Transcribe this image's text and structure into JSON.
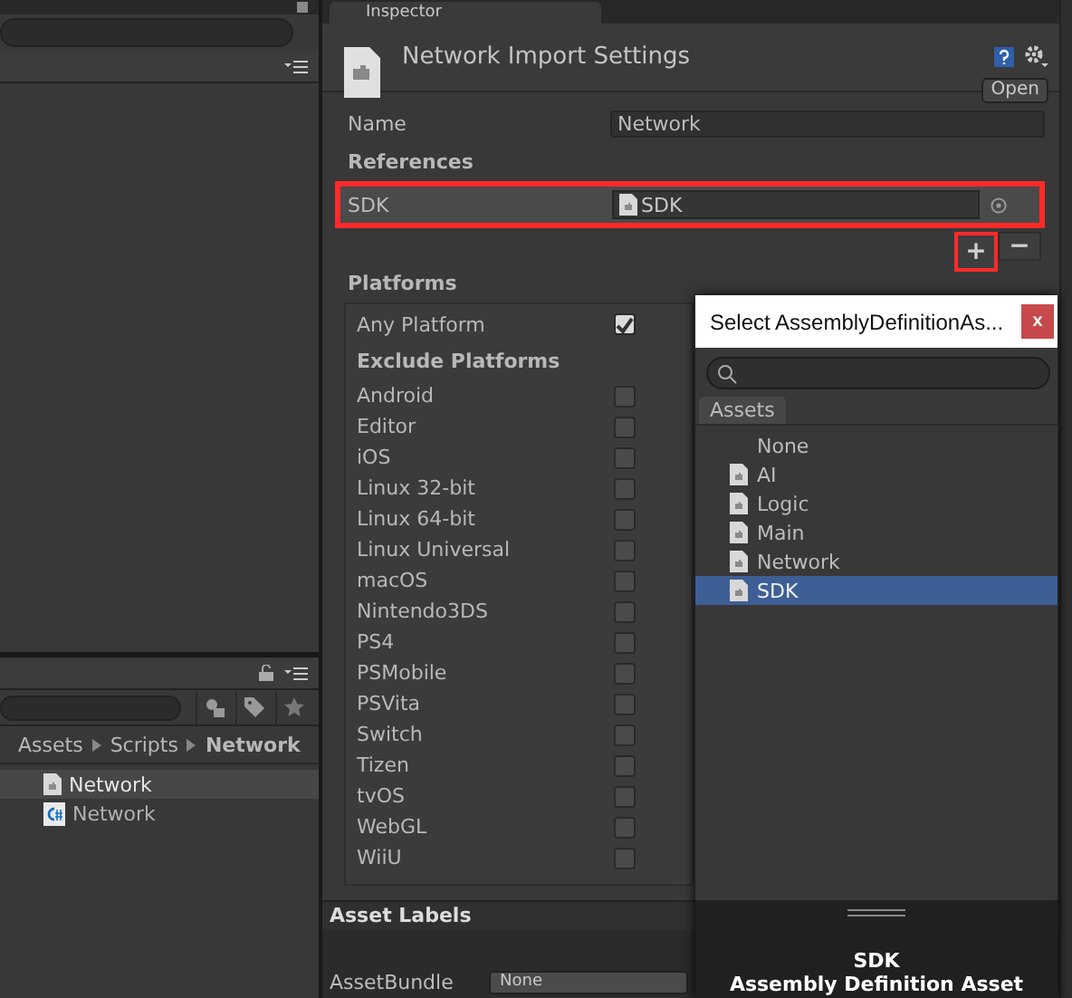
{
  "project": {
    "breadcrumbs": [
      {
        "label": "Assets",
        "current": false
      },
      {
        "label": "Scripts",
        "current": false
      },
      {
        "label": "Network",
        "current": true
      }
    ],
    "files": [
      {
        "name": "Network",
        "kind": "assembly",
        "selected": true
      },
      {
        "name": "Network",
        "kind": "script",
        "selected": false
      }
    ]
  },
  "inspector": {
    "tab": "Inspector",
    "title": "Network Import Settings",
    "open_button": "Open",
    "name_label": "Name",
    "name_value": "Network",
    "references_heading": "References",
    "references": [
      {
        "label": "SDK",
        "value": "SDK",
        "highlighted": true
      }
    ],
    "add_button": {
      "label": "+",
      "highlighted": true
    },
    "remove_button": {
      "label": "−",
      "highlighted": false
    },
    "platforms_heading": "Platforms",
    "any_platform": {
      "label": "Any Platform",
      "checked": true
    },
    "exclude_heading": "Exclude Platforms",
    "platforms": [
      {
        "label": "Android",
        "checked": false
      },
      {
        "label": "Editor",
        "checked": false
      },
      {
        "label": "iOS",
        "checked": false
      },
      {
        "label": "Linux 32-bit",
        "checked": false
      },
      {
        "label": "Linux 64-bit",
        "checked": false
      },
      {
        "label": "Linux Universal",
        "checked": false
      },
      {
        "label": "macOS",
        "checked": false
      },
      {
        "label": "Nintendo3DS",
        "checked": false
      },
      {
        "label": "PS4",
        "checked": false
      },
      {
        "label": "PSMobile",
        "checked": false
      },
      {
        "label": "PSVita",
        "checked": false
      },
      {
        "label": "Switch",
        "checked": false
      },
      {
        "label": "Tizen",
        "checked": false
      },
      {
        "label": "tvOS",
        "checked": false
      },
      {
        "label": "WebGL",
        "checked": false
      },
      {
        "label": "WiiU",
        "checked": false
      }
    ],
    "asset_labels": "Asset Labels",
    "asset_bundle": {
      "label": "AssetBundle",
      "value": "None"
    }
  },
  "picker": {
    "title": "Select AssemblyDefinitionAs...",
    "close": "x",
    "tab": "Assets",
    "items": [
      {
        "name": "None",
        "kind": "none",
        "selected": false
      },
      {
        "name": "AI",
        "kind": "assembly",
        "selected": false
      },
      {
        "name": "Logic",
        "kind": "assembly",
        "selected": false
      },
      {
        "name": "Main",
        "kind": "assembly",
        "selected": false
      },
      {
        "name": "Network",
        "kind": "assembly",
        "selected": false
      },
      {
        "name": "SDK",
        "kind": "assembly",
        "selected": true
      }
    ],
    "preview_name": "SDK",
    "preview_type": "Assembly Definition Asset"
  }
}
